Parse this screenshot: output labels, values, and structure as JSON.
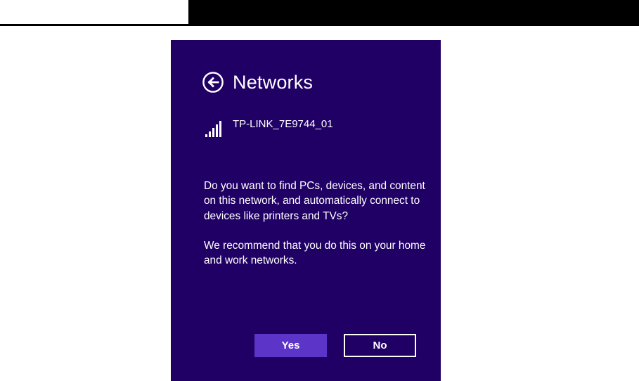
{
  "panel": {
    "title": "Networks",
    "back_icon": "back-arrow-icon",
    "network": {
      "ssid": "TP-LINK_7E9744_01",
      "icon": "wifi-signal-icon"
    },
    "message": {
      "question": "Do you want to find PCs, devices, and content on this network, and automatically connect to devices like printers and TVs?",
      "recommendation": "We recommend that you do this on your home and work networks."
    },
    "buttons": {
      "yes_label": "Yes",
      "no_label": "No"
    }
  },
  "colors": {
    "panel_background": "#210066",
    "accent": "#5d34c8",
    "text": "#ffffff"
  }
}
